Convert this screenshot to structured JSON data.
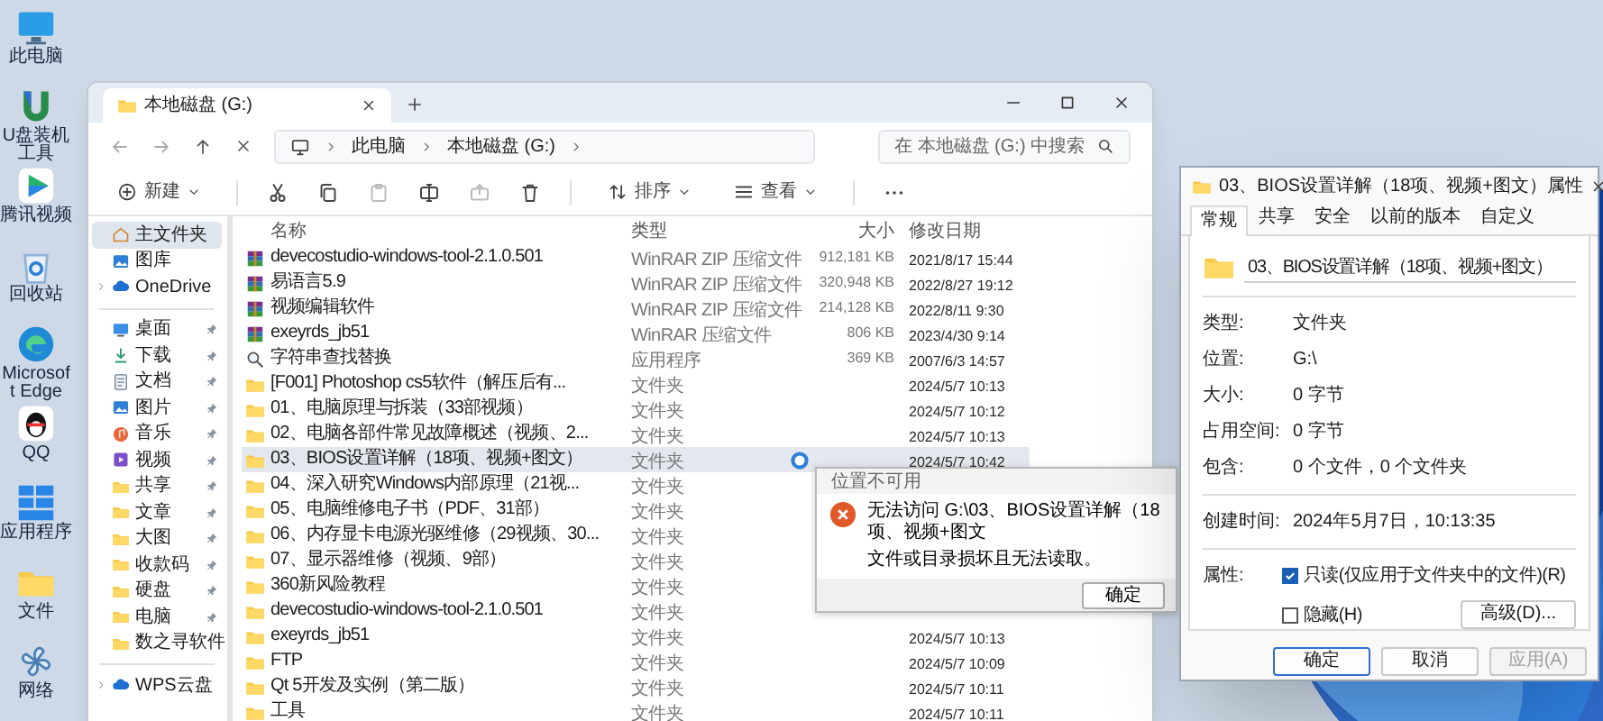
{
  "desktop_icons": [
    {
      "label": "此电脑",
      "kind": "computer"
    },
    {
      "label": "U盘装机工具",
      "kind": "installer"
    },
    {
      "label": "腾讯视频",
      "kind": "player"
    },
    {
      "label": "回收站",
      "kind": "recycle"
    },
    {
      "label": "Microsoft Edge",
      "kind": "browser"
    },
    {
      "label": "QQ",
      "kind": "chat"
    },
    {
      "label": "应用程序",
      "kind": "tiles"
    },
    {
      "label": "文件",
      "kind": "folder"
    },
    {
      "label": "网络",
      "kind": "pinwheel"
    }
  ],
  "explorer": {
    "tab_title": "本地磁盘 (G:)",
    "breadcrumb": [
      "此电脑",
      "本地磁盘 (G:)"
    ],
    "search": {
      "placeholder": "在 本地磁盘 (G:) 中搜索"
    },
    "toolbar": {
      "new": "新建",
      "sort": "排序",
      "view": "查看"
    },
    "sidebar": [
      [
        {
          "label": "主文件夹",
          "kind": "home",
          "selected": true
        },
        {
          "label": "图库",
          "kind": "gallery",
          "selected": false
        },
        {
          "label": "OneDrive",
          "kind": "cloud",
          "selected": false,
          "expanded": false
        }
      ],
      [
        {
          "label": "桌面",
          "kind": "desktop",
          "selected": false,
          "pinned": true
        },
        {
          "label": "下载",
          "kind": "download",
          "selected": false,
          "pinned": true
        },
        {
          "label": "文档",
          "kind": "document",
          "selected": false,
          "pinned": true
        },
        {
          "label": "图片",
          "kind": "picture",
          "selected": false,
          "pinned": true
        },
        {
          "label": "音乐",
          "kind": "music",
          "selected": false,
          "pinned": true
        },
        {
          "label": "视频",
          "kind": "video",
          "selected": false,
          "pinned": true
        },
        {
          "label": "共享",
          "kind": "folder",
          "selected": false,
          "pinned": true
        },
        {
          "label": "文章",
          "kind": "folder",
          "selected": false,
          "pinned": true
        },
        {
          "label": "大图",
          "kind": "folder",
          "selected": false,
          "pinned": true
        },
        {
          "label": "收款码",
          "kind": "folder",
          "selected": false,
          "pinned": true
        },
        {
          "label": "硬盘",
          "kind": "folder",
          "selected": false,
          "pinned": true
        },
        {
          "label": "电脑",
          "kind": "folder",
          "selected": false,
          "pinned": true
        },
        {
          "label": "数之寻软件",
          "kind": "folder",
          "selected": false,
          "pinned": false
        }
      ],
      [
        {
          "label": "WPS云盘",
          "kind": "cloud",
          "selected": false,
          "expanded": false
        }
      ]
    ],
    "columns": [
      "名称",
      "类型",
      "大小",
      "修改日期"
    ],
    "files": [
      {
        "name": "devecostudio-windows-tool-2.1.0.501",
        "kind": "zip",
        "type": "WinRAR ZIP 压缩文件",
        "size": "912,181 KB",
        "date": "2021/8/17 15:44",
        "selected": false
      },
      {
        "name": "易语言5.9",
        "kind": "zip",
        "type": "WinRAR ZIP 压缩文件",
        "size": "320,948 KB",
        "date": "2022/8/27 19:12",
        "selected": false
      },
      {
        "name": "视频编辑软件",
        "kind": "zip",
        "type": "WinRAR ZIP 压缩文件",
        "size": "214,128 KB",
        "date": "2022/8/11 9:30",
        "selected": false
      },
      {
        "name": "exeyrds_jb51",
        "kind": "zip",
        "type": "WinRAR 压缩文件",
        "size": "806 KB",
        "date": "2023/4/30 9:14",
        "selected": false
      },
      {
        "name": "字符串查找替换",
        "kind": "app",
        "type": "应用程序",
        "size": "369 KB",
        "date": "2007/6/3 14:57",
        "selected": false
      },
      {
        "name": "[F001] Photoshop cs5软件（解压后有...",
        "kind": "folder",
        "type": "文件夹",
        "date": "2024/5/7 10:13",
        "selected": false
      },
      {
        "name": "01、电脑原理与拆装（33部视频）",
        "kind": "folder",
        "type": "文件夹",
        "date": "2024/5/7 10:12",
        "selected": false
      },
      {
        "name": "02、电脑各部件常见故障概述（视频、2...",
        "kind": "folder",
        "type": "文件夹",
        "date": "2024/5/7 10:13",
        "selected": false
      },
      {
        "name": "03、BIOS设置详解（18项、视频+图文）",
        "kind": "folder",
        "type": "文件夹",
        "date": "2024/5/7 10:42",
        "selected": true
      },
      {
        "name": "04、深入研究Windows内部原理（21视...",
        "kind": "folder",
        "type": "文件夹",
        "selected": false
      },
      {
        "name": "05、电脑维修电子书（PDF、31部）",
        "kind": "folder",
        "type": "文件夹",
        "selected": false
      },
      {
        "name": "06、内存显卡电源光驱维修（29视频、30...",
        "kind": "folder",
        "type": "文件夹",
        "selected": false
      },
      {
        "name": "07、显示器维修（视频、9部）",
        "kind": "folder",
        "type": "文件夹",
        "selected": false
      },
      {
        "name": "360新风险教程",
        "kind": "folder",
        "type": "文件夹",
        "selected": false
      },
      {
        "name": "devecostudio-windows-tool-2.1.0.501",
        "kind": "folder",
        "type": "文件夹",
        "selected": false
      },
      {
        "name": "exeyrds_jb51",
        "kind": "folder",
        "type": "文件夹",
        "date": "2024/5/7 10:13",
        "selected": false
      },
      {
        "name": "FTP",
        "kind": "folder",
        "type": "文件夹",
        "date": "2024/5/7 10:09",
        "selected": false
      },
      {
        "name": "Qt 5开发及实例（第二版）",
        "kind": "folder",
        "type": "文件夹",
        "date": "2024/5/7 10:11",
        "selected": false
      },
      {
        "name": "工具",
        "kind": "folder",
        "type": "文件夹",
        "date": "2024/5/7 10:11",
        "selected": false
      }
    ]
  },
  "error_dialog": {
    "title": "位置不可用",
    "message": "无法访问 G:\\03、BIOS设置详解（18项、视频+图文",
    "detail": "文件或目录损坏且无法读取。",
    "button": "确定"
  },
  "properties": {
    "title": "03、BIOS设置详解（18项、视频+图文）属性",
    "tabs": [
      {
        "label": "常规",
        "selected": true
      },
      {
        "label": "共享",
        "selected": false
      },
      {
        "label": "安全",
        "selected": false
      },
      {
        "label": "以前的版本",
        "selected": false
      },
      {
        "label": "自定义",
        "selected": false
      }
    ],
    "name": "03、BIOS设置详解（18项、视频+图文）",
    "info": [
      {
        "label": "类型:",
        "value": "文件夹"
      },
      {
        "label": "位置:",
        "value": "G:\\"
      },
      {
        "label": "大小:",
        "value": "0 字节"
      },
      {
        "label": "占用空间:",
        "value": "0 字节"
      },
      {
        "label": "包含:",
        "value": "0 个文件，0 个文件夹"
      }
    ],
    "created": {
      "label": "创建时间:",
      "value": "2024年5月7日，10:13:35"
    },
    "attributes": {
      "label": "属性:",
      "options": [
        {
          "label": "只读(仅应用于文件夹中的文件)(R)",
          "checked": true
        },
        {
          "label": "隐藏(H)",
          "checked": false
        }
      ],
      "advanced": "高级(D)..."
    },
    "buttons": [
      {
        "label": "确定",
        "disabled": false,
        "default": true
      },
      {
        "label": "取消",
        "disabled": false,
        "default": false
      },
      {
        "label": "应用(A)",
        "disabled": true,
        "default": false
      }
    ]
  }
}
